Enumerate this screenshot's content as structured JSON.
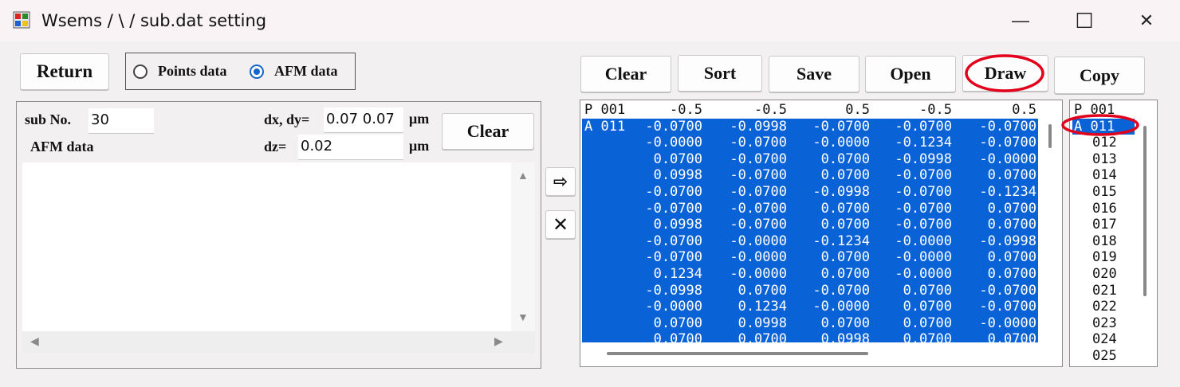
{
  "window": {
    "title": "Wsems / \\ / sub.dat setting",
    "minimize": "—",
    "maximize": "☐",
    "close": "✕"
  },
  "top_left": {
    "return_label": "Return",
    "radio_points": "Points data",
    "radio_afm": "AFM data",
    "selected": "AFM data"
  },
  "left_panel": {
    "sub_no_label": "sub No.",
    "sub_no_value": "30",
    "dxdy_label": "dx, dy=",
    "dxdy_value": "0.07 0.07",
    "dxdy_unit": "μm",
    "dz_label": "dz=",
    "dz_value": "0.02",
    "dz_unit": "μm",
    "afm_label": "AFM data",
    "clear_label": "Clear"
  },
  "arrow_buttons": {
    "transfer": "⇨",
    "delete": "✕"
  },
  "toolbar": {
    "clear": "Clear",
    "sort": "Sort",
    "save": "Save",
    "open": "Open",
    "draw": "Draw",
    "copy": "Copy"
  },
  "data_grid": {
    "header": {
      "prefix": "P 001",
      "cells": [
        "-0.5",
        "-0.5",
        "0.5",
        "-0.5",
        "0.5"
      ]
    },
    "rows": [
      {
        "prefix": "A 011",
        "cells": [
          "-0.0700",
          "-0.0998",
          "-0.0700",
          "-0.0700",
          "-0.0700"
        ]
      },
      {
        "prefix": "",
        "cells": [
          "-0.0000",
          "-0.0700",
          "-0.0000",
          "-0.1234",
          "-0.0700"
        ]
      },
      {
        "prefix": "",
        "cells": [
          "0.0700",
          "-0.0700",
          "0.0700",
          "-0.0998",
          "-0.0000"
        ]
      },
      {
        "prefix": "",
        "cells": [
          "0.0998",
          "-0.0700",
          "0.0700",
          "-0.0700",
          "0.0700"
        ]
      },
      {
        "prefix": "",
        "cells": [
          "-0.0700",
          "-0.0700",
          "-0.0998",
          "-0.0700",
          "-0.1234"
        ]
      },
      {
        "prefix": "",
        "cells": [
          "-0.0700",
          "-0.0700",
          "0.0700",
          "-0.0700",
          "0.0700"
        ]
      },
      {
        "prefix": "",
        "cells": [
          "0.0998",
          "-0.0700",
          "0.0700",
          "-0.0700",
          "0.0700"
        ]
      },
      {
        "prefix": "",
        "cells": [
          "-0.0700",
          "-0.0000",
          "-0.1234",
          "-0.0000",
          "-0.0998"
        ]
      },
      {
        "prefix": "",
        "cells": [
          "-0.0700",
          "-0.0000",
          "0.0700",
          "-0.0000",
          "0.0700"
        ]
      },
      {
        "prefix": "",
        "cells": [
          "0.1234",
          "-0.0000",
          "0.0700",
          "-0.0000",
          "0.0700"
        ]
      },
      {
        "prefix": "",
        "cells": [
          "-0.0998",
          "0.0700",
          "-0.0700",
          "0.0700",
          "-0.0700"
        ]
      },
      {
        "prefix": "",
        "cells": [
          "-0.0000",
          "0.1234",
          "-0.0000",
          "0.0700",
          "-0.0700"
        ]
      },
      {
        "prefix": "",
        "cells": [
          "0.0700",
          "0.0998",
          "0.0700",
          "0.0700",
          "-0.0000"
        ]
      },
      {
        "prefix": "",
        "cells": [
          "0.0700",
          "0.0700",
          "0.0998",
          "0.0700",
          "0.0700"
        ]
      }
    ]
  },
  "id_list": {
    "items": [
      "P 001",
      "A 011",
      "012",
      "013",
      "014",
      "015",
      "016",
      "017",
      "018",
      "019",
      "020",
      "021",
      "022",
      "023",
      "024",
      "025"
    ],
    "selected_index": 1
  },
  "colors": {
    "selection": "#0a63d6",
    "highlight_circle": "#e3001b"
  }
}
